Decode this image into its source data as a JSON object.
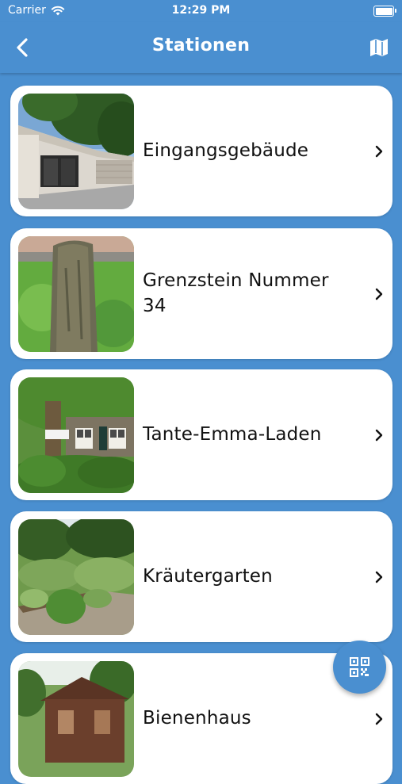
{
  "status_bar": {
    "carrier": "Carrier",
    "time": "12:29 PM",
    "wifi_icon": "wifi-icon",
    "battery_icon": "battery-icon"
  },
  "nav": {
    "title": "Stationen",
    "back_icon": "chevron-left-icon",
    "map_icon": "map-icon"
  },
  "stations": [
    {
      "label": "Eingangsgebäude",
      "image": "modern building photo"
    },
    {
      "label": "Grenzstein Nummer 34",
      "image": "stone pillar photo"
    },
    {
      "label": "Tante-Emma-Laden",
      "image": "house with tree photo"
    },
    {
      "label": "Kräutergarten",
      "image": "herb garden photo"
    },
    {
      "label": "Bienenhaus",
      "image": "wooden shed photo"
    }
  ],
  "fab": {
    "icon": "qr-code-icon"
  },
  "colors": {
    "accent": "#4a8fd0",
    "card": "#ffffff",
    "text": "#111111"
  }
}
